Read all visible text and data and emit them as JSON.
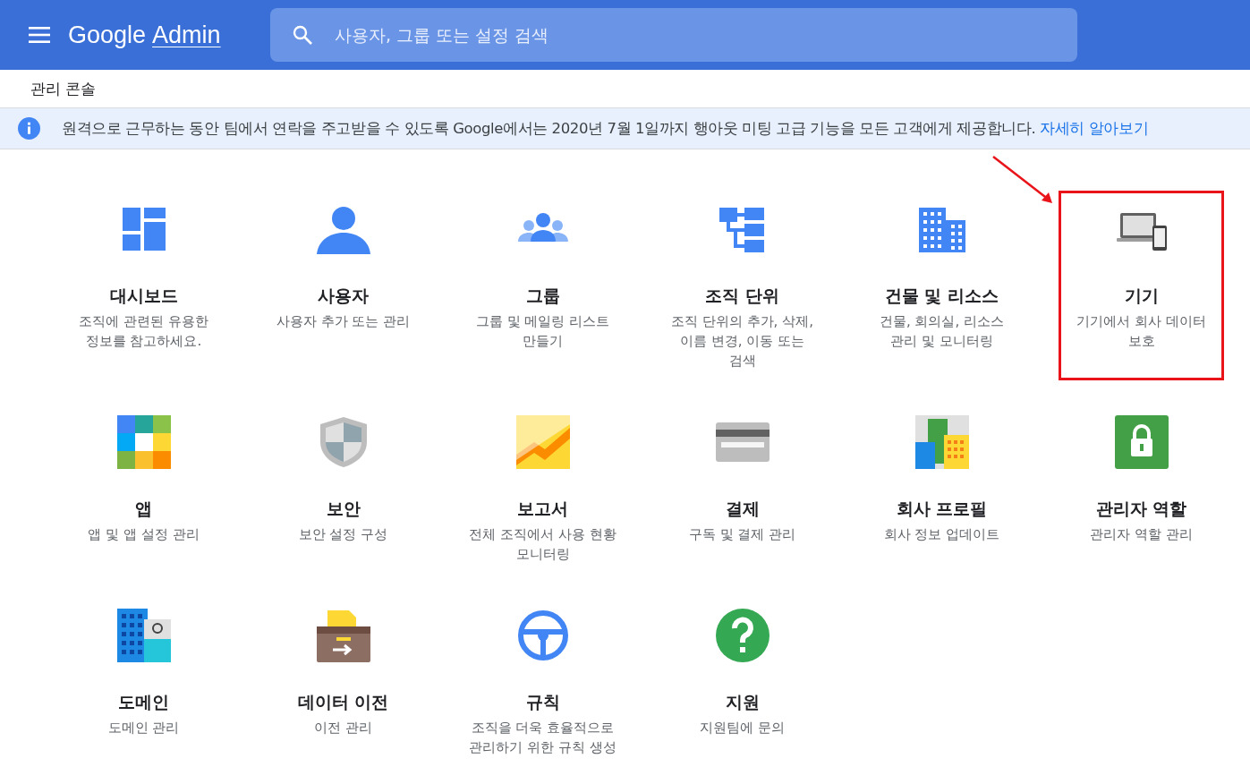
{
  "header": {
    "logo_brand": "Google",
    "logo_product": "Admin",
    "search": {
      "placeholder": "사용자, 그룹 또는 설정 검색"
    }
  },
  "breadcrumb": "관리 콘솔",
  "banner": {
    "text": "원격으로 근무하는 동안 팀에서 연락을 주고받을 수 있도록 Google에서는 2020년 7월 1일까지 행아웃 미팅 고급 기능을 모든 고객에게 제공합니다.",
    "link": "자세히 알아보기"
  },
  "tiles": [
    {
      "kind": "dashboard",
      "title": "대시보드",
      "description": "조직에 관련된 유용한 정보를 참고하세요.",
      "highlighted": false
    },
    {
      "kind": "users",
      "title": "사용자",
      "description": "사용자 추가 또는 관리",
      "highlighted": false
    },
    {
      "kind": "groups",
      "title": "그룹",
      "description": "그룹 및 메일링 리스트 만들기",
      "highlighted": false
    },
    {
      "kind": "org",
      "title": "조직 단위",
      "description": "조직 단위의 추가, 삭제, 이름 변경, 이동 또는 검색",
      "highlighted": false
    },
    {
      "kind": "buildings",
      "title": "건물 및 리소스",
      "description": "건물, 회의실, 리소스 관리 및 모니터링",
      "highlighted": false
    },
    {
      "kind": "devices",
      "title": "기기",
      "description": "기기에서 회사 데이터 보호",
      "highlighted": true
    },
    {
      "kind": "apps",
      "title": "앱",
      "description": "앱 및 앱 설정 관리",
      "highlighted": false
    },
    {
      "kind": "security",
      "title": "보안",
      "description": "보안 설정 구성",
      "highlighted": false
    },
    {
      "kind": "reports",
      "title": "보고서",
      "description": "전체 조직에서 사용 현황 모니터링",
      "highlighted": false
    },
    {
      "kind": "billing",
      "title": "결제",
      "description": "구독 및 결제 관리",
      "highlighted": false
    },
    {
      "kind": "company",
      "title": "회사 프로필",
      "description": "회사 정보 업데이트",
      "highlighted": false
    },
    {
      "kind": "roles",
      "title": "관리자 역할",
      "description": "관리자 역할 관리",
      "highlighted": false
    },
    {
      "kind": "domains",
      "title": "도메인",
      "description": "도메인 관리",
      "highlighted": false
    },
    {
      "kind": "migration",
      "title": "데이터 이전",
      "description": "이전 관리",
      "highlighted": false
    },
    {
      "kind": "rules",
      "title": "규칙",
      "description": "조직을 더욱 효율적으로 관리하기 위한 규칙 생성",
      "highlighted": false
    },
    {
      "kind": "support",
      "title": "지원",
      "description": "지원팀에 문의",
      "highlighted": false
    }
  ]
}
